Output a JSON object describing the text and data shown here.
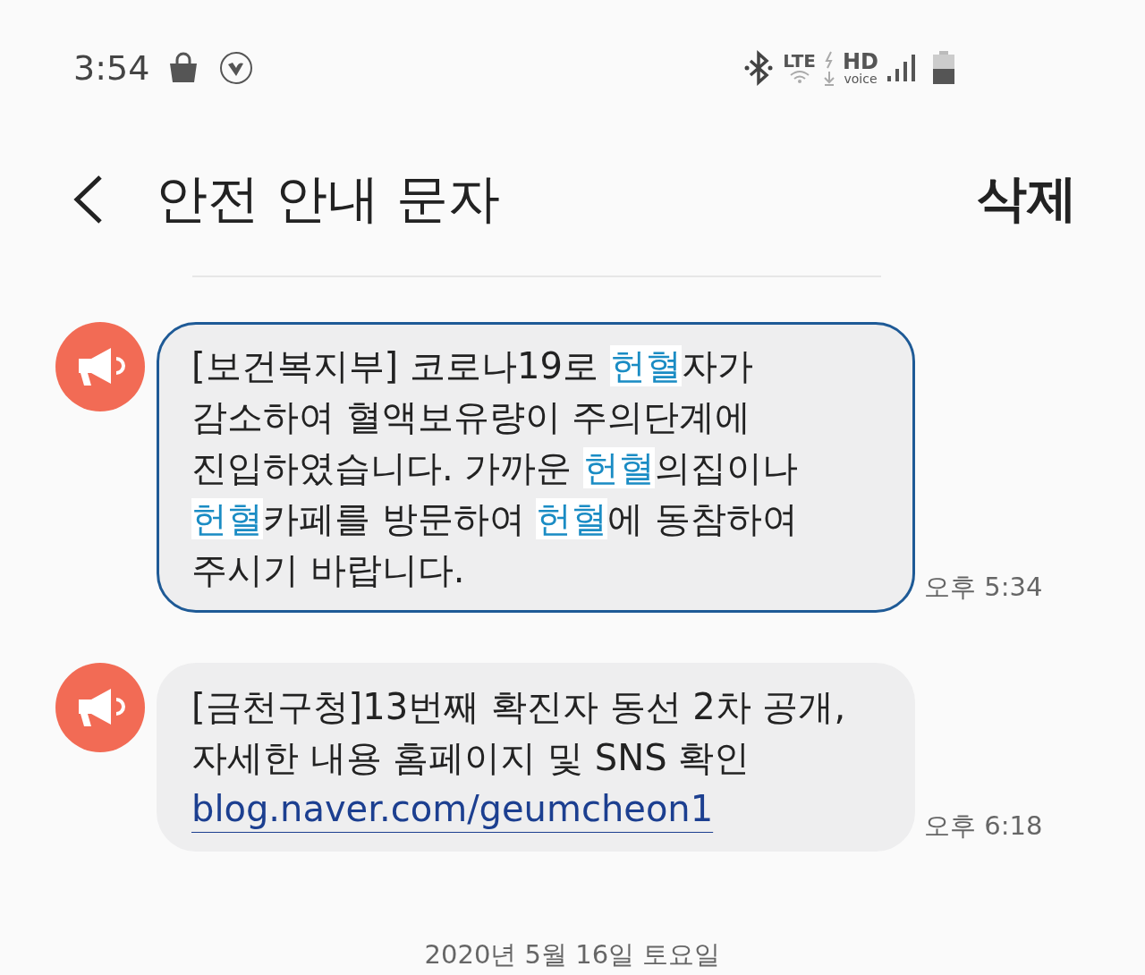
{
  "status_bar": {
    "time": "3:54",
    "network": "LTE",
    "hd": "HD",
    "voice": "voice"
  },
  "header": {
    "title": "안전 안내 문자",
    "action": "삭제"
  },
  "messages": [
    {
      "text": "[보건복지부] 코로나19로 **헌혈**자가\n감소하여 혈액보유량이 주의단계에\n진입하였습니다. 가까운 **헌혈**의집이나\n**헌혈**카페를 방문하여 **헌혈**에 동참하여\n주시기 바랍니다.",
      "time": "오후 5:34",
      "selected": true
    },
    {
      "text": "[금천구청]13번째 확진자 동선 2차 공개,\n자세한 내용 홈페이지 및 SNS 확인",
      "link": "blog.naver.com/geumcheon1",
      "time": "오후 6:18",
      "selected": false
    }
  ],
  "date_divider": "2020년 5월 16일 토요일"
}
